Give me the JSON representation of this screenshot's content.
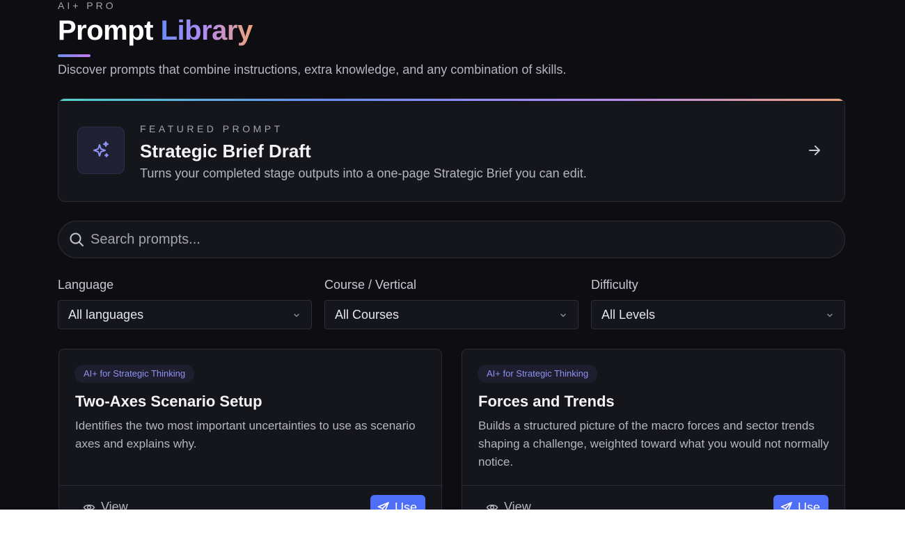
{
  "header": {
    "eyebrow": "AI+ PRO",
    "title_part1": "Prompt",
    "title_part2": "Library",
    "subtitle": "Discover prompts that combine instructions, extra knowledge, and any combination of skills."
  },
  "featured": {
    "eyebrow": "FEATURED PROMPT",
    "title": "Strategic Brief Draft",
    "description": "Turns your completed stage outputs into a one-page Strategic Brief you can edit.",
    "icon": "sparkles-icon",
    "action_icon": "arrow-right-icon"
  },
  "search": {
    "placeholder": "Search prompts...",
    "value": "",
    "icon": "search-icon"
  },
  "filters": [
    {
      "label": "Language",
      "selected": "All languages"
    },
    {
      "label": "Course / Vertical",
      "selected": "All Courses"
    },
    {
      "label": "Difficulty",
      "selected": "All Levels"
    }
  ],
  "cards": [
    {
      "badge": "AI+ for Strategic Thinking",
      "title": "Two-Axes Scenario Setup",
      "description": "Identifies the two most important uncertainties to use as scenario axes and explains why.",
      "view_label": "View",
      "use_label": "Use"
    },
    {
      "badge": "AI+ for Strategic Thinking",
      "title": "Forces and Trends",
      "description": "Builds a structured picture of the macro forces and sector trends shaping a challenge, weighted toward what you would not normally notice.",
      "view_label": "View",
      "use_label": "Use"
    }
  ],
  "colors": {
    "background": "#0d0d12",
    "card": "#15151c",
    "accent": "#4f6ef7",
    "badge_text": "#8f92f0"
  }
}
